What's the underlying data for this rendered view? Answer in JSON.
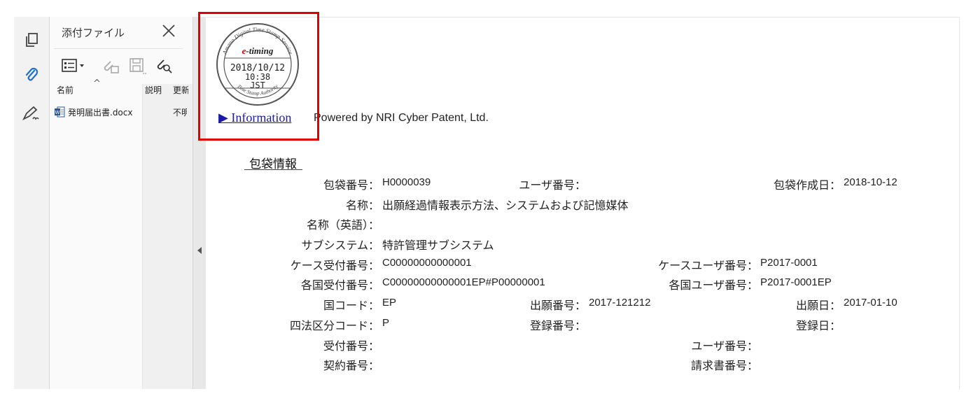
{
  "panel": {
    "title": "添付ファイル",
    "columns": {
      "name": "名前",
      "sort_indicator": "^",
      "desc": "説明",
      "modified": "更新"
    },
    "file": {
      "name": "発明届出書.docx",
      "modified": "不明"
    }
  },
  "rail": {
    "icons": [
      "pages-icon",
      "attachment-icon",
      "signature-icon"
    ]
  },
  "stamp": {
    "outer_text": "Amano Digital Time Stamp Service",
    "bottom_text": "Time Stamp Authority",
    "logo": "e-timing",
    "date": "2018/10/12",
    "time": "10:38",
    "zone": "JST"
  },
  "info": {
    "link": "▶ Information",
    "powered": "Powered by NRI Cyber Patent, Ltd."
  },
  "section": {
    "title": "包袋情報"
  },
  "fields": [
    {
      "label": "包袋番号：",
      "value": "H0000039"
    },
    {
      "label": "ユーザ番号：",
      "value": ""
    },
    {
      "label": "包袋作成日：",
      "value": "2018-10-12"
    },
    {
      "label": "名称：",
      "value": "出願経過情報表示方法、システムおよび記憶媒体"
    },
    {
      "label": "名称（英語）：",
      "value": ""
    },
    {
      "label": "サブシステム：",
      "value": "特許管理サブシステム"
    },
    {
      "label": "ケース受付番号：",
      "value": "C00000000000001"
    },
    {
      "label": "ケースユーザ番号：",
      "value": "P2017-0001"
    },
    {
      "label": "各国受付番号：",
      "value": "C00000000000001EP#P00000001"
    },
    {
      "label": "各国ユーザ番号：",
      "value": "P2017-0001EP"
    },
    {
      "label": "国コード：",
      "value": "EP"
    },
    {
      "label": "出願番号：",
      "value": "2017-121212"
    },
    {
      "label": "出願日：",
      "value": "2017-01-10"
    },
    {
      "label": "四法区分コード：",
      "value": "P"
    },
    {
      "label": "登録番号：",
      "value": ""
    },
    {
      "label": "登録日：",
      "value": ""
    },
    {
      "label": "受付番号：",
      "value": ""
    },
    {
      "label": "ユーザ番号：",
      "value": ""
    },
    {
      "label": "契約番号：",
      "value": ""
    },
    {
      "label": "請求書番号：",
      "value": ""
    }
  ]
}
